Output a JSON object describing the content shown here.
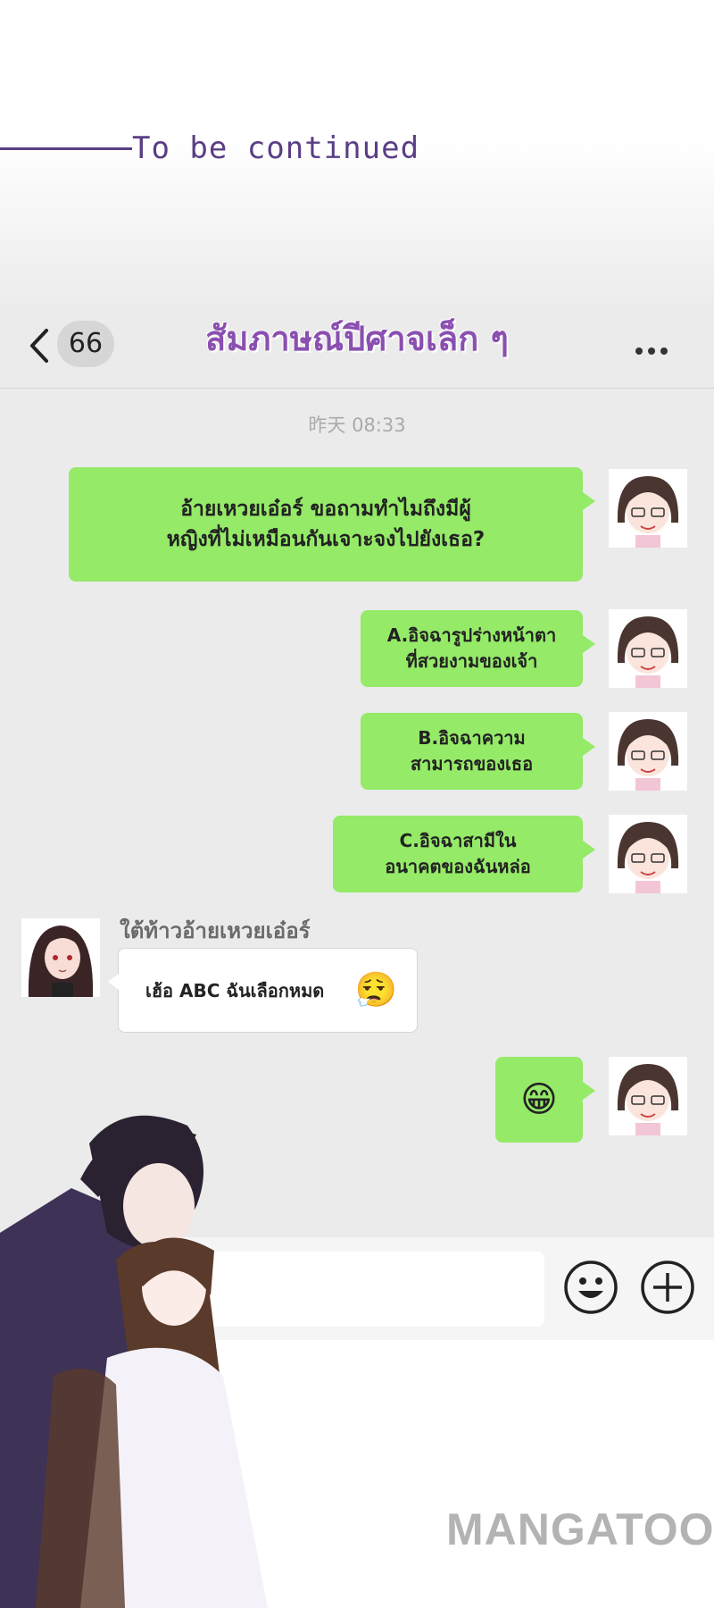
{
  "banner": {
    "text": "To be continued"
  },
  "header": {
    "back_count": "66",
    "title": "สัมภาษณ์ปีศาจเล็ก ๆ"
  },
  "timestamp": "昨天 08:33",
  "messages": [
    {
      "lines": [
        "อ้ายเหวยเอ๋อร์ ขอถามทำไมถึงมีผู้",
        "หญิงที่ไม่เหมือนกันเจาะจงไปยังเธอ?"
      ]
    },
    {
      "lines": [
        "A.อิจฉารูปร่างหน้าตา",
        "ที่สวยงามของเจ้า"
      ]
    },
    {
      "lines": [
        "B.อิจฉาความ",
        "สามารถของเธอ"
      ]
    },
    {
      "lines": [
        "C.อิจฉาสามีใน",
        "อนาคตของฉันหล่อ"
      ]
    }
  ],
  "incoming": {
    "sender": "ใต้ท้าวอ้ายเหวยเอ๋อร์",
    "text": "เฮ้อ ABC ฉันเลือกหมด",
    "emoji": "😮‍💨"
  },
  "reply_emoji": "😁",
  "input": {
    "placeholder": ""
  },
  "icons": {
    "back": "chevron-left-icon",
    "more": "more-dots-icon",
    "emoji": "smiley-icon",
    "plus": "plus-circle-icon"
  },
  "colors": {
    "outgoing_bubble": "#95ea68",
    "title": "#8a4fb0",
    "banner": "#5a3e85"
  },
  "watermark": "MANGATOON"
}
